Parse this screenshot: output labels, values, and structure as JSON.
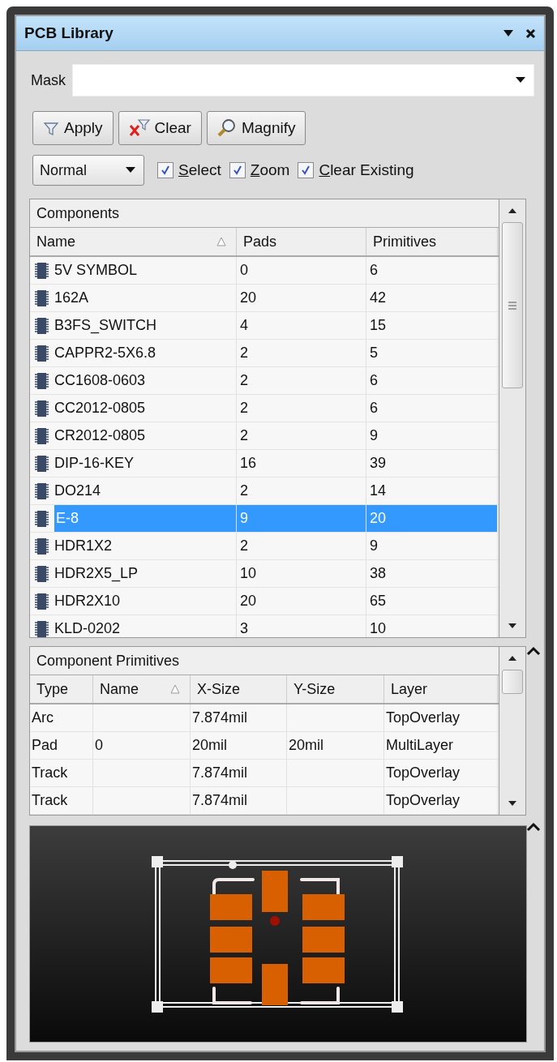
{
  "panel": {
    "title": "PCB Library"
  },
  "mask": {
    "label": "Mask"
  },
  "buttons": [
    {
      "label": "Apply",
      "kind": "filter"
    },
    {
      "label": "Clear",
      "kind": "clear"
    },
    {
      "label": "Magnify",
      "kind": "magnify"
    }
  ],
  "mode": {
    "value": "Normal"
  },
  "options": [
    {
      "label": "Select",
      "checked": true
    },
    {
      "label": "Zoom",
      "checked": true
    },
    {
      "label": "Clear Existing",
      "checked": true
    }
  ],
  "components": {
    "title": "Components",
    "columns": [
      {
        "label": "Name",
        "sorted": true
      },
      {
        "label": "Pads",
        "sorted": false
      },
      {
        "label": "Primitives",
        "sorted": false
      }
    ],
    "rows": [
      {
        "cells": [
          "5V SYMBOL",
          "0",
          "6"
        ],
        "selected": false
      },
      {
        "cells": [
          "162A",
          "20",
          "42"
        ],
        "selected": false
      },
      {
        "cells": [
          "B3FS_SWITCH",
          "4",
          "15"
        ],
        "selected": false
      },
      {
        "cells": [
          "CAPPR2-5X6.8",
          "2",
          "5"
        ],
        "selected": false
      },
      {
        "cells": [
          "CC1608-0603",
          "2",
          "6"
        ],
        "selected": false
      },
      {
        "cells": [
          "CC2012-0805",
          "2",
          "6"
        ],
        "selected": false
      },
      {
        "cells": [
          "CR2012-0805",
          "2",
          "9"
        ],
        "selected": false
      },
      {
        "cells": [
          "DIP-16-KEY",
          "16",
          "39"
        ],
        "selected": false
      },
      {
        "cells": [
          "DO214",
          "2",
          "14"
        ],
        "selected": false
      },
      {
        "cells": [
          "E-8",
          "9",
          "20"
        ],
        "selected": true
      },
      {
        "cells": [
          "HDR1X2",
          "2",
          "9"
        ],
        "selected": false
      },
      {
        "cells": [
          "HDR2X5_LP",
          "10",
          "38"
        ],
        "selected": false
      },
      {
        "cells": [
          "HDR2X10",
          "20",
          "65"
        ],
        "selected": false
      },
      {
        "cells": [
          "KLD-0202",
          "3",
          "10"
        ],
        "selected": false
      }
    ]
  },
  "primitives": {
    "title": "Component Primitives",
    "columns": [
      {
        "label": "Type",
        "sorted": false
      },
      {
        "label": "Name",
        "sorted": true
      },
      {
        "label": "X-Size",
        "sorted": false
      },
      {
        "label": "Y-Size",
        "sorted": false
      },
      {
        "label": "Layer",
        "sorted": false
      }
    ],
    "rows": [
      {
        "cells": [
          "Arc",
          "",
          "7.874mil",
          "",
          "TopOverlay"
        ],
        "selected": false
      },
      {
        "cells": [
          "Pad",
          "0",
          "20mil",
          "20mil",
          "MultiLayer"
        ],
        "selected": false
      },
      {
        "cells": [
          "Track",
          "",
          "7.874mil",
          "",
          "TopOverlay"
        ],
        "selected": false
      },
      {
        "cells": [
          "Track",
          "",
          "7.874mil",
          "",
          "TopOverlay"
        ],
        "selected": false
      }
    ]
  }
}
